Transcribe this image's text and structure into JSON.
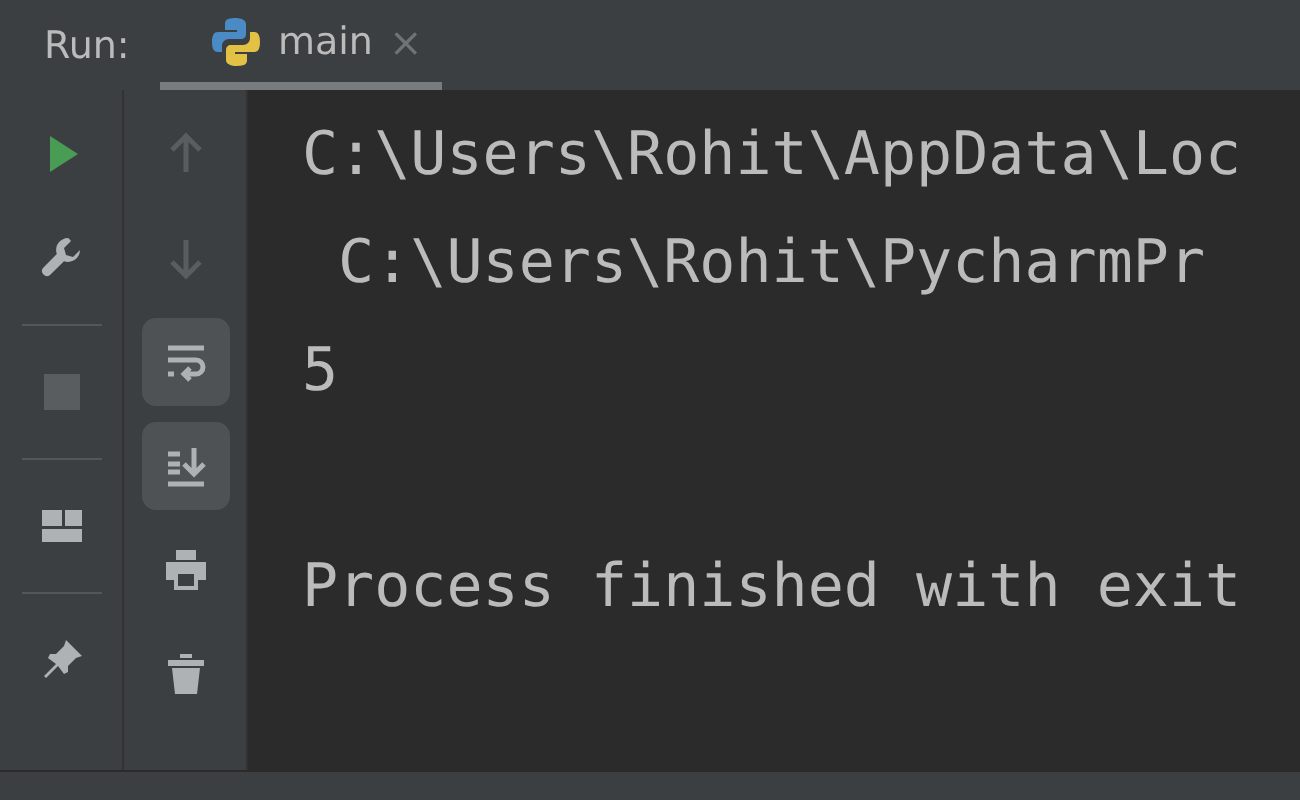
{
  "run_label": "Run:",
  "tabs": [
    {
      "label": "main",
      "close": "×",
      "selected": true
    }
  ],
  "left_toolbar": [
    {
      "disabled": false
    },
    {
      "disabled": false
    },
    {
      "disabled": true
    },
    {
      "disabled": false
    },
    {
      "disabled": false
    }
  ],
  "console_toolbar": [
    {
      "disabled": true,
      "on": false
    },
    {
      "disabled": true,
      "on": false
    },
    {
      "disabled": false,
      "on": true
    },
    {
      "disabled": false,
      "on": true
    },
    {
      "disabled": false,
      "on": false
    },
    {
      "disabled": false,
      "on": false
    }
  ],
  "console_lines": [
    "C:\\Users\\Rohit\\AppData\\Loc",
    " C:\\Users\\Rohit\\PycharmPr",
    "5"
  ],
  "exit_message": "Process finished with exit"
}
